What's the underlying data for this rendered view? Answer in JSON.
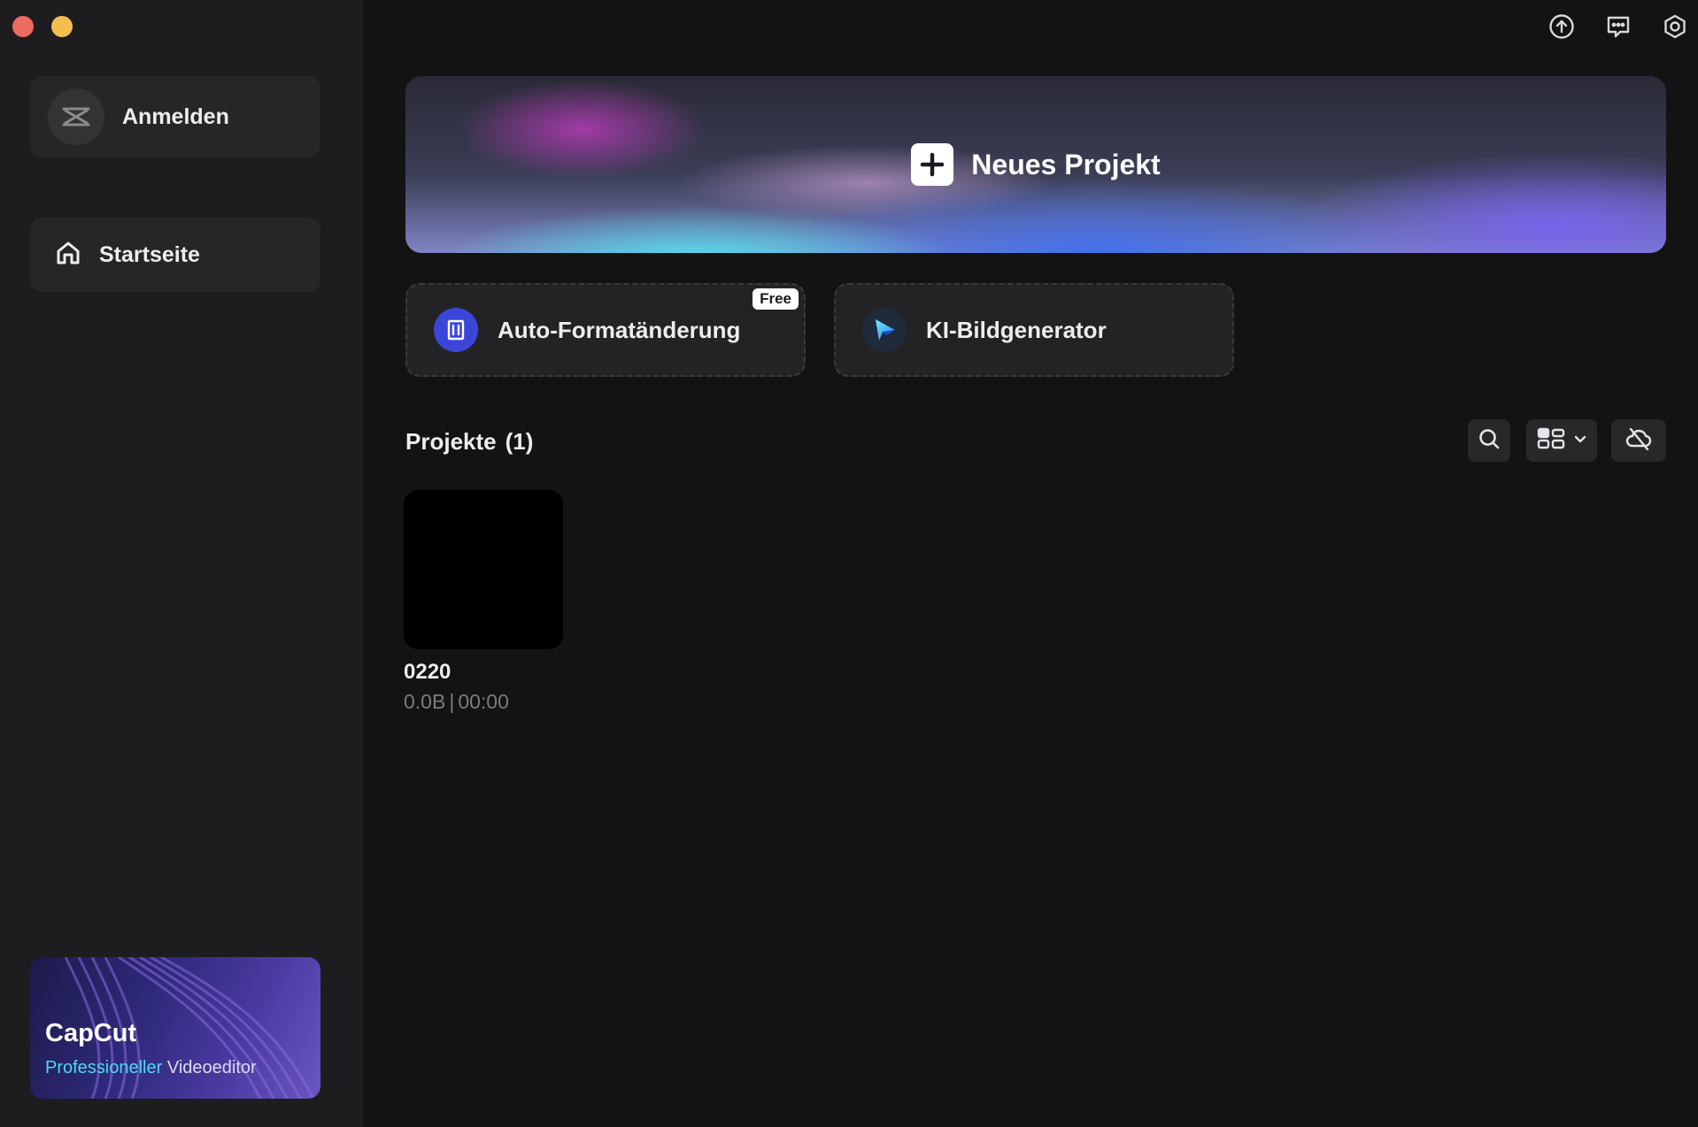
{
  "sidebar": {
    "login_label": "Anmelden",
    "nav": [
      {
        "label": "Startseite",
        "icon": "home-icon"
      }
    ],
    "promo": {
      "title": "CapCut",
      "sub_accent": "Professioneller",
      "sub_rest": " Videoeditor"
    }
  },
  "header_icons": [
    "upload-icon",
    "feedback-icon",
    "settings-icon"
  ],
  "new_project": {
    "label": "Neues Projekt"
  },
  "tools": [
    {
      "label": "Auto-Formatänderung",
      "badge": "Free",
      "icon": "auto-reframe-icon"
    },
    {
      "label": "KI-Bildgenerator",
      "icon": "ai-image-generator-icon"
    }
  ],
  "projects": {
    "title": "Projekte",
    "count": "(1)",
    "items": [
      {
        "name": "0220",
        "size": "0.0B",
        "separator": "|",
        "duration": "00:00"
      }
    ]
  },
  "colors": {
    "background": "#131313",
    "sidebar": "#1d1d1f",
    "card": "#262628",
    "accent_cyan": "#4fd8f0",
    "traffic_red": "#ed6a5e",
    "traffic_yellow": "#f4be4f"
  }
}
